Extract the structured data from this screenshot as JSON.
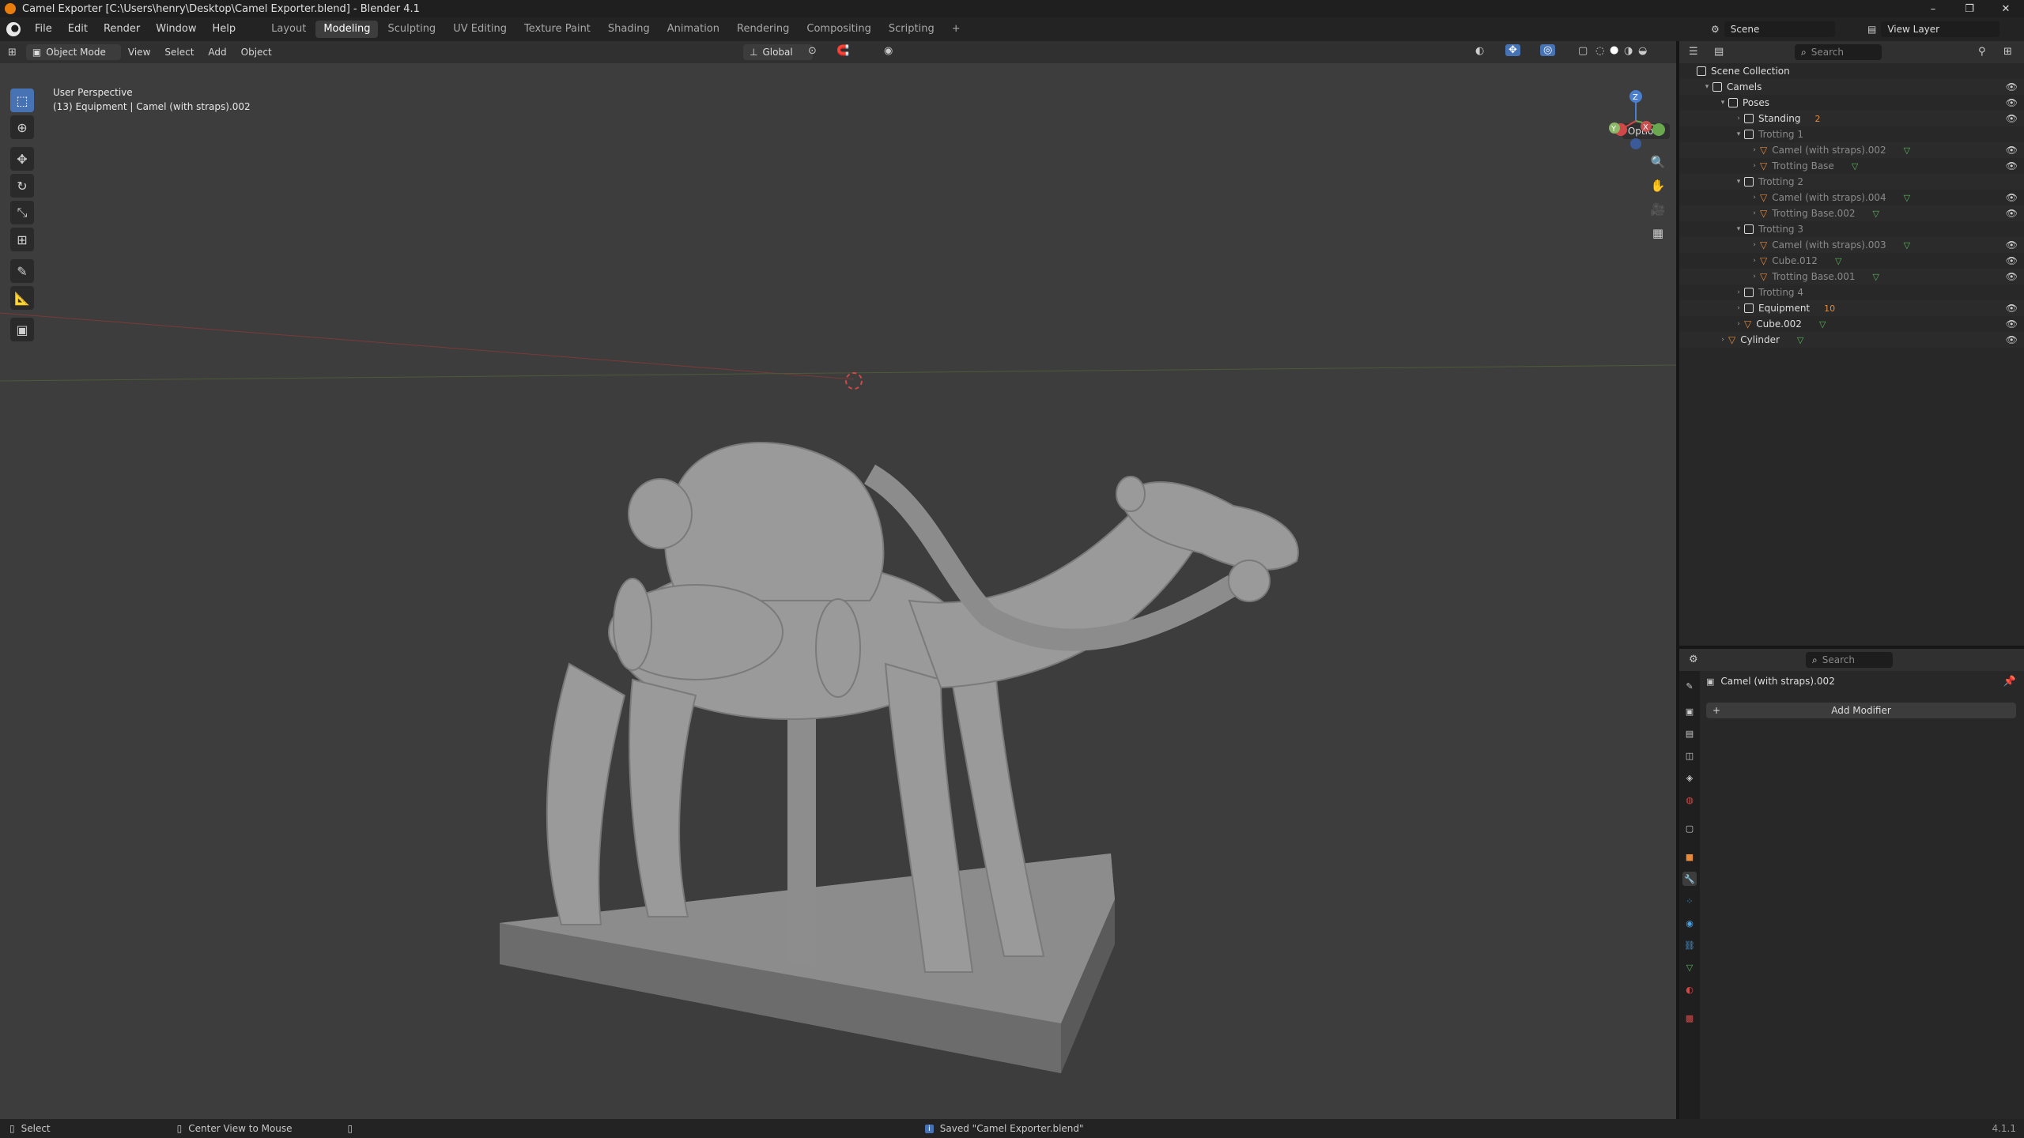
{
  "window": {
    "title": "Camel Exporter [C:\\Users\\henry\\Desktop\\Camel Exporter.blend] - Blender 4.1",
    "controls": [
      "–",
      "❐",
      "✕"
    ]
  },
  "menu": [
    "File",
    "Edit",
    "Render",
    "Window",
    "Help"
  ],
  "workspaces": [
    {
      "label": "Layout",
      "active": false
    },
    {
      "label": "Modeling",
      "active": true
    },
    {
      "label": "Sculpting",
      "active": false
    },
    {
      "label": "UV Editing",
      "active": false
    },
    {
      "label": "Texture Paint",
      "active": false
    },
    {
      "label": "Shading",
      "active": false
    },
    {
      "label": "Animation",
      "active": false
    },
    {
      "label": "Rendering",
      "active": false
    },
    {
      "label": "Compositing",
      "active": false
    },
    {
      "label": "Scripting",
      "active": false
    }
  ],
  "add_workspace": "+",
  "scene": {
    "name": "Scene",
    "view_layer": "View Layer"
  },
  "viewport_header": {
    "mode": "Object Mode",
    "menus": [
      "View",
      "Select",
      "Add",
      "Object"
    ],
    "orientation": "Global",
    "options_label": "Options"
  },
  "viewport": {
    "perspective_label": "User Perspective",
    "object_info": "(13) Equipment | Camel (with straps).002",
    "gizmo_axes": {
      "x": "X",
      "y": "Y",
      "z": "Z"
    }
  },
  "toolbar": [
    "select-box",
    "cursor",
    "move",
    "rotate",
    "scale",
    "transform",
    "annotate",
    "measure",
    "add-cube"
  ],
  "outliner": {
    "search_placeholder": "Search",
    "rows": [
      {
        "label": "Scene Collection",
        "depth": 0,
        "type": "collection",
        "arrow": "",
        "eye": false,
        "dim": false
      },
      {
        "label": "Camels",
        "depth": 1,
        "type": "collection",
        "arrow": "▾",
        "eye": true,
        "dim": false
      },
      {
        "label": "Poses",
        "depth": 2,
        "type": "collection",
        "arrow": "▾",
        "eye": true,
        "dim": false
      },
      {
        "label": "Standing",
        "depth": 3,
        "type": "collection",
        "arrow": "›",
        "eye": true,
        "dim": false,
        "badge": "2"
      },
      {
        "label": "Trotting 1",
        "depth": 3,
        "type": "collection",
        "arrow": "▾",
        "eye": false,
        "dim": true
      },
      {
        "label": "Camel (with straps).002",
        "depth": 4,
        "type": "mesh",
        "arrow": "›",
        "eye": true,
        "dim": true
      },
      {
        "label": "Trotting Base",
        "depth": 4,
        "type": "mesh",
        "arrow": "›",
        "eye": true,
        "dim": true
      },
      {
        "label": "Trotting 2",
        "depth": 3,
        "type": "collection",
        "arrow": "▾",
        "eye": false,
        "dim": true
      },
      {
        "label": "Camel (with straps).004",
        "depth": 4,
        "type": "mesh",
        "arrow": "›",
        "eye": true,
        "dim": true
      },
      {
        "label": "Trotting Base.002",
        "depth": 4,
        "type": "mesh",
        "arrow": "›",
        "eye": true,
        "dim": true
      },
      {
        "label": "Trotting 3",
        "depth": 3,
        "type": "collection",
        "arrow": "▾",
        "eye": false,
        "dim": true
      },
      {
        "label": "Camel (with straps).003",
        "depth": 4,
        "type": "mesh",
        "arrow": "›",
        "eye": true,
        "dim": true
      },
      {
        "label": "Cube.012",
        "depth": 4,
        "type": "mesh",
        "arrow": "›",
        "eye": true,
        "dim": true
      },
      {
        "label": "Trotting Base.001",
        "depth": 4,
        "type": "mesh",
        "arrow": "›",
        "eye": true,
        "dim": true
      },
      {
        "label": "Trotting 4",
        "depth": 3,
        "type": "collection",
        "arrow": "›",
        "eye": false,
        "dim": true
      },
      {
        "label": "Equipment",
        "depth": 3,
        "type": "collection",
        "arrow": "›",
        "eye": true,
        "dim": false,
        "badge": "10"
      },
      {
        "label": "Cube.002",
        "depth": 3,
        "type": "mesh",
        "arrow": "›",
        "eye": true,
        "dim": false
      },
      {
        "label": "Cylinder",
        "depth": 2,
        "type": "mesh",
        "arrow": "›",
        "eye": true,
        "dim": false
      }
    ]
  },
  "properties": {
    "search_placeholder": "Search",
    "object_name": "Camel (with straps).002",
    "add_modifier": "Add Modifier"
  },
  "statusbar": {
    "left": "Select",
    "middle": "Center View to Mouse",
    "message": "Saved \"Camel Exporter.blend\"",
    "version": "4.1.1"
  },
  "colors": {
    "accent": "#4772b3",
    "orange": "#e87d0d",
    "green": "#5ab65a"
  }
}
